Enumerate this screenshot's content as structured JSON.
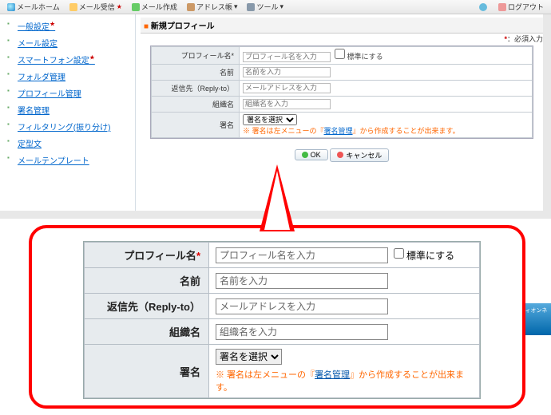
{
  "toolbar": {
    "left": [
      {
        "id": "home",
        "label": "メールホーム"
      },
      {
        "id": "recv",
        "label": "メール受信",
        "badge": true
      },
      {
        "id": "compose",
        "label": "メール作成"
      },
      {
        "id": "addr",
        "label": "アドレス帳"
      },
      {
        "id": "tool",
        "label": "ツール"
      }
    ],
    "help": "?",
    "logout": "ログアウト"
  },
  "sidebar": {
    "items": [
      {
        "label": "一般設定",
        "badge": true
      },
      {
        "label": "メール設定"
      },
      {
        "label": "スマートフォン設定",
        "badge": true
      },
      {
        "label": "フォルダ管理"
      },
      {
        "label": "プロフィール管理"
      },
      {
        "label": "署名管理"
      },
      {
        "label": "フィルタリング(振り分け)"
      },
      {
        "label": "定型文"
      },
      {
        "label": "メールテンプレート"
      }
    ]
  },
  "panel": {
    "title": "新規プロフィール",
    "required_hint": "：必須入力",
    "rows": {
      "profile_name": {
        "label": "プロフィール名",
        "required": true,
        "placeholder": "プロフィール名を入力",
        "checkbox": "標準にする"
      },
      "name": {
        "label": "名前",
        "placeholder": "名前を入力"
      },
      "reply": {
        "label": "返信先（Reply-to）",
        "placeholder": "メールアドレスを入力"
      },
      "org": {
        "label": "組織名",
        "placeholder": "組織名を入力"
      },
      "sign": {
        "label": "署名",
        "select": "署名を選択",
        "note_a": "※ 署名は左メニューの『",
        "note_link": "署名管理",
        "note_b": "』から作成することが出来ます。"
      }
    },
    "ok": "OK",
    "cancel": "キャンセル"
  },
  "footer": "エディオンネット"
}
